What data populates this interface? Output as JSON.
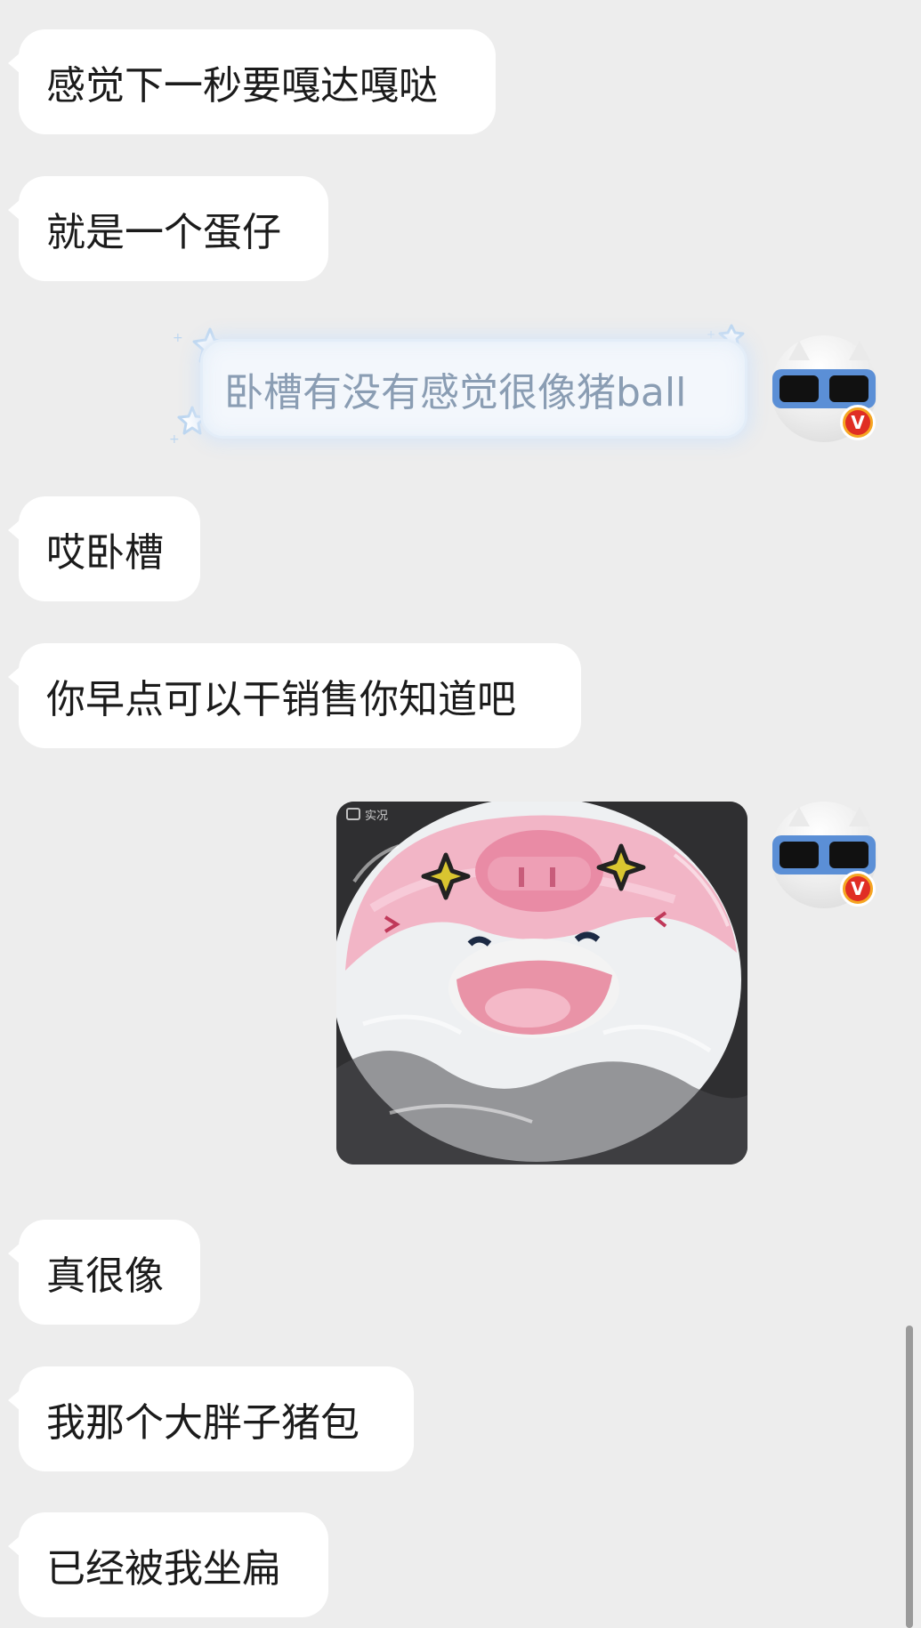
{
  "messages": [
    {
      "side": "left",
      "text": "感觉下一秒要嘎达嘎哒"
    },
    {
      "side": "left",
      "text": "就是一个蛋仔"
    },
    {
      "side": "right",
      "text": "卧槽有没有感觉很像猪ball"
    },
    {
      "side": "left",
      "text": "哎卧槽"
    },
    {
      "side": "left",
      "text": "你早点可以干销售你知道吧"
    },
    {
      "side": "right",
      "type": "image",
      "image_label": "实况",
      "image_alt": "pink and white pig plush face wrapped in plastic"
    },
    {
      "side": "left",
      "text": "真很像"
    },
    {
      "side": "left",
      "text": "我那个大胖子猪包"
    },
    {
      "side": "left",
      "text": "已经被我坐扁"
    }
  ],
  "avatar": {
    "badge_text": "V",
    "icon": "sunglasses-cat-avatar"
  },
  "colors": {
    "background": "#ededed",
    "bubble_left": "#ffffff",
    "bubble_right_text": "#8a9db3",
    "badge": "#e02e24"
  }
}
